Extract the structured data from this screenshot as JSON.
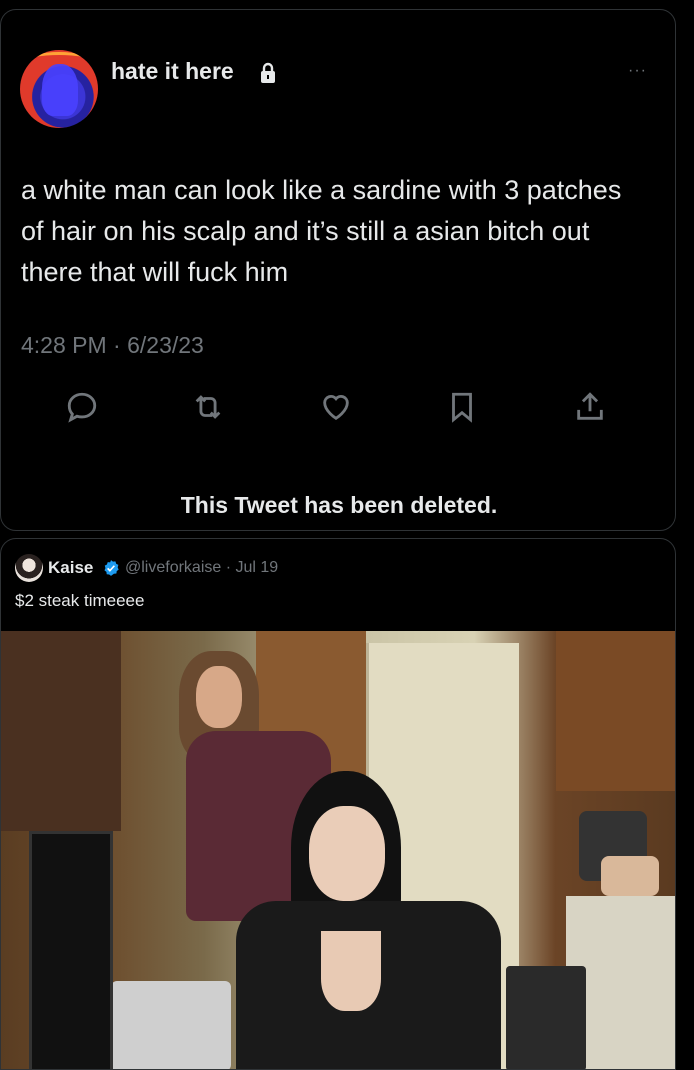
{
  "tweet1": {
    "username": "hate it here",
    "text": "a white man can look like a sardine with 3 patches of hair on his scalp and it’s still a asian bitch out there that will fuck him",
    "timestamp": "4:28 PM · 6/23/23",
    "more_label": "···",
    "deleted_notice": "This Tweet has been deleted.",
    "icons": [
      "lock-icon",
      "reply-icon",
      "retweet-icon",
      "like-icon",
      "bookmark-icon",
      "share-icon"
    ]
  },
  "tweet2": {
    "display_name": "Kaise",
    "handle_date": "@liveforkaise · Jul 19",
    "text": "$2 steak timeeee",
    "icons": [
      "verified-badge-icon"
    ],
    "colors": {
      "verified": "#1d9bf0"
    }
  },
  "colors": {
    "background": "#000000",
    "text": "#e7e9ea",
    "muted": "#71767b",
    "border": "#2f3336"
  }
}
